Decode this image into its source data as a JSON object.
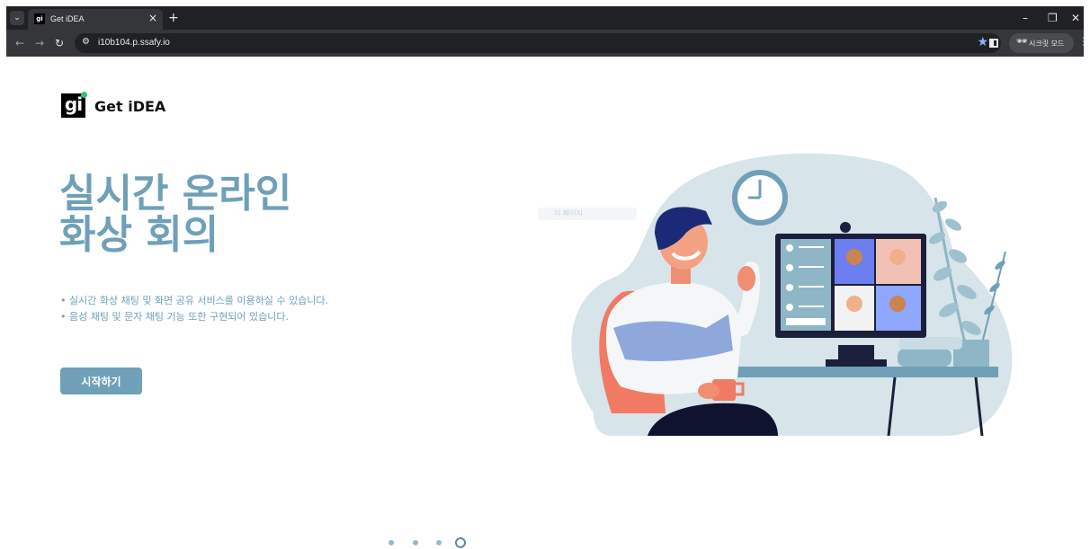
{
  "browser": {
    "tab_title": "Get iDEA",
    "favicon_text": "gi",
    "url": "i10b104.p.ssafy.io",
    "incognito_label": "시크릿 모드"
  },
  "logo": {
    "mark": "gi",
    "text": "Get iDEA",
    "dot_color": "#2ec27e"
  },
  "hero": {
    "title_line1": "실시간 온라인",
    "title_line2": "화상 회의",
    "bullet1": "• 실시간 화상 채팅 및 화면 공유 서비스를 이용하실 수 있습니다.",
    "bullet2": "• 음성 채팅 및 문자 채팅 기능 또한 구현되어 있습니다.",
    "cta_label": "시작하기",
    "accent_color": "#6fa0b8"
  },
  "ghost_text": "이 페이지",
  "carousel": {
    "total": 4,
    "active_index": 3
  }
}
